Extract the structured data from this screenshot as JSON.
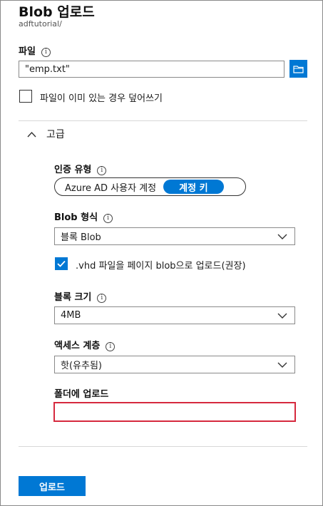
{
  "panel": {
    "title": "Blob 업로드",
    "breadcrumb": "adftutorial/"
  },
  "file": {
    "label": "파일",
    "value": "\"emp.txt\""
  },
  "overwrite": {
    "label": "파일이 이미 있는 경우 덮어쓰기",
    "checked": false
  },
  "advanced": {
    "label": "고급",
    "expanded": true
  },
  "auth": {
    "label": "인증 유형",
    "options": [
      "Azure AD 사용자 계정",
      "계정 키"
    ],
    "selected": "계정 키"
  },
  "blob_type": {
    "label": "Blob 형식",
    "value": "블록 Blob"
  },
  "vhd": {
    "label": ".vhd 파일을 페이지 blob으로 업로드(권장)",
    "checked": true
  },
  "block_size": {
    "label": "블록 크기",
    "value": "4MB"
  },
  "access_tier": {
    "label": "액세스 계층",
    "value": "핫(유추됨)"
  },
  "folder": {
    "label": "폴더에 업로드",
    "value": ""
  },
  "actions": {
    "upload_label": "업로드"
  },
  "colors": {
    "accent": "#0078d4",
    "highlight": "#d6293e"
  },
  "icons": {
    "info": "info-icon",
    "folder": "folder-icon",
    "chevron_up": "chevron-up-icon",
    "chevron_down": "chevron-down-icon",
    "check": "checkmark-icon"
  }
}
